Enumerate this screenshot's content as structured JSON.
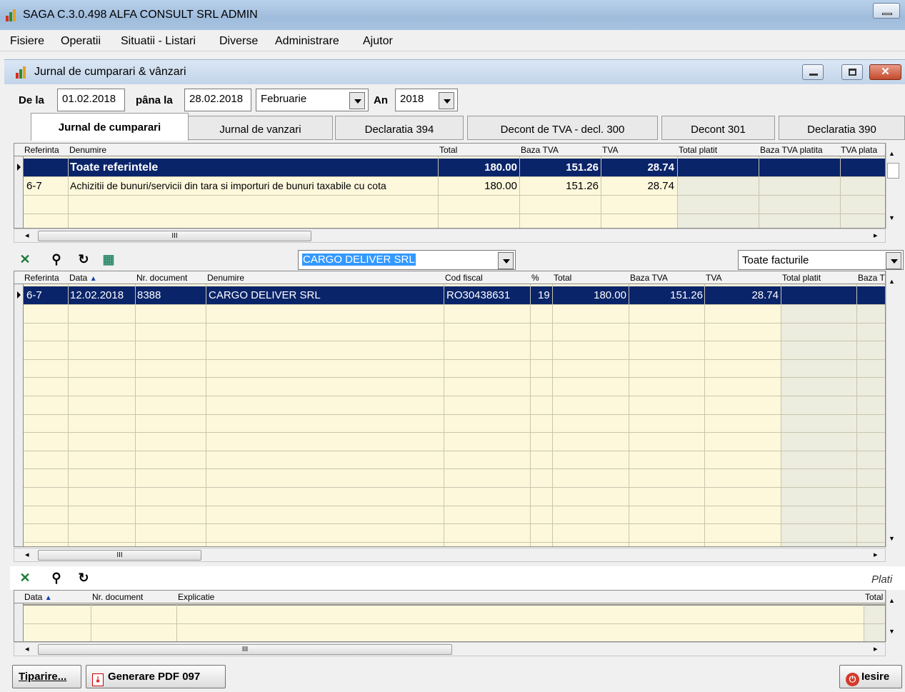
{
  "app": {
    "title": "SAGA C.3.0.498  ALFA CONSULT SRL  ADMIN"
  },
  "menu": [
    "Fisiere",
    "Operatii",
    "Situatii - Listari",
    "Diverse",
    "Administrare",
    "Ajutor"
  ],
  "window": {
    "title": "Jurnal de cumparari & vânzari"
  },
  "filters": {
    "from_label": "De la",
    "from_value": "01.02.2018",
    "to_label": "pâna la",
    "to_value": "28.02.2018",
    "month_value": "Februarie",
    "year_label": "An",
    "year_value": "2018"
  },
  "tabs": [
    "Jurnal de cumparari",
    "Jurnal de vanzari",
    "Declaratia 394",
    "Decont de TVA - decl. 300",
    "Decont 301",
    "Declaratia 390"
  ],
  "active_tab": "Jurnal de cumparari",
  "summary_grid": {
    "columns": [
      "Referinta",
      "Denumire",
      "Total",
      "Baza TVA",
      "TVA",
      "Total platit",
      "Baza TVA platita",
      "TVA plata"
    ],
    "rows": [
      {
        "ref": "",
        "name": "Toate referintele",
        "total": "180.00",
        "baza": "151.26",
        "tva": "28.74",
        "selected": true
      },
      {
        "ref": "6-7",
        "name": "Achizitii de bunuri/servicii din tara si importuri de bunuri taxabile cu cota",
        "total": "180.00",
        "baza": "151.26",
        "tva": "28.74",
        "selected": false
      }
    ]
  },
  "partner_filter": {
    "value": "CARGO DELIVER SRL"
  },
  "invoice_filter": {
    "value": "Toate facturile"
  },
  "detail_grid": {
    "columns": [
      "Referinta",
      "Data",
      "Nr. document",
      "Denumire",
      "Cod fiscal",
      "%",
      "Total",
      "Baza TVA",
      "TVA",
      "Total platit",
      "Baza T"
    ],
    "rows": [
      {
        "ref": "6-7",
        "date": "12.02.2018",
        "doc": "8388",
        "name": "CARGO DELIVER SRL",
        "cif": "RO30438631",
        "pct": "19",
        "total": "180.00",
        "baza": "151.26",
        "tva": "28.74"
      }
    ]
  },
  "payments": {
    "title": "Plati",
    "columns": [
      "Data",
      "Nr. document",
      "Explicatie",
      "Total"
    ]
  },
  "buttons": {
    "print": "Tiparire...",
    "pdf": "Generare PDF 097",
    "exit": "Iesire"
  },
  "scroll_marker": "III"
}
